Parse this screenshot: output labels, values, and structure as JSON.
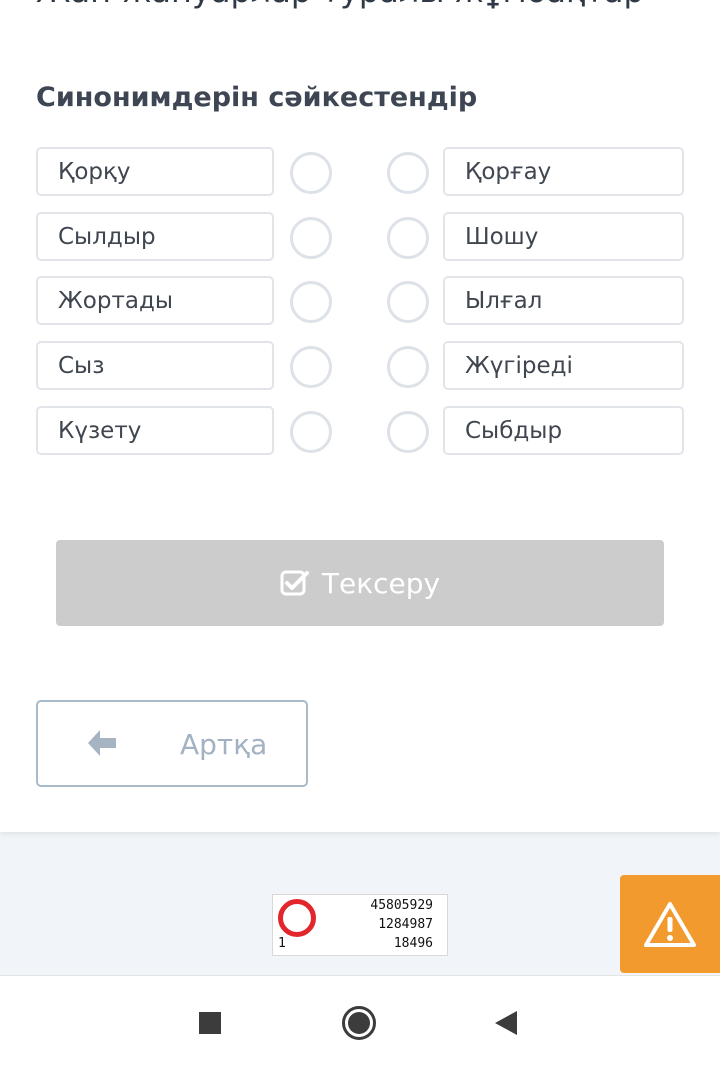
{
  "page": {
    "title": "Жан-жануарлар туралы жұмбақтар"
  },
  "task": {
    "title": "Синонимдерін сәйкестендір",
    "left_words": [
      "Қорқу",
      "Сылдыр",
      "Жортады",
      "Сыз",
      "Күзету"
    ],
    "right_words": [
      "Қорғау",
      "Шошу",
      "Ылғал",
      "Жүгіреді",
      "Сыбдыр"
    ]
  },
  "buttons": {
    "check_label": "Тексеру",
    "back_label": "Артқа"
  },
  "counter": {
    "line1": "45805929",
    "line2": "1284987",
    "line3": "18496",
    "corner": "1"
  },
  "colors": {
    "check_button_bg": "#cccccc",
    "warning_bg": "#f39a2f",
    "counter_ring": "#e3262c"
  },
  "icons": {
    "check": "checkbox-check-icon",
    "back": "arrow-left-icon",
    "warning": "warning-triangle-icon",
    "nav_recent": "square-icon",
    "nav_home": "circle-icon",
    "nav_back": "triangle-back-icon"
  }
}
